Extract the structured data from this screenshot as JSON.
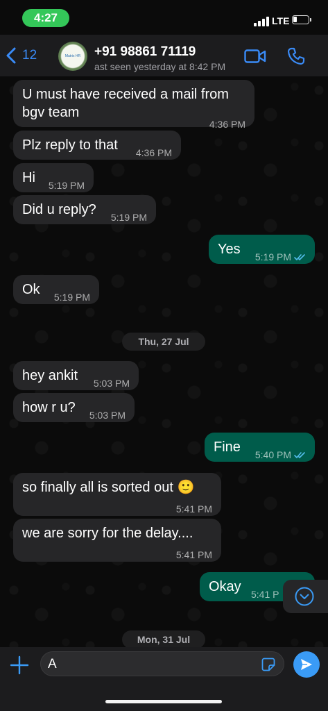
{
  "status_bar": {
    "time": "4:27",
    "network": "LTE",
    "time_pill_color": "#34c759"
  },
  "header": {
    "back_count": "12",
    "contact_name": "+91 98861 71119",
    "contact_status": "ast seen yesterday at 8:42 PM",
    "avatar_text": "Matrix HR",
    "accent_color": "#3a8bf7",
    "icons": [
      "chevron-left-icon",
      "video-call-icon",
      "phone-icon"
    ]
  },
  "messages": [
    {
      "dir": "in",
      "text1": "U must have received a mail from",
      "text2": "bgv team",
      "time": "4:36 PM"
    },
    {
      "dir": "in",
      "text": "Plz reply to that",
      "time": "4:36 PM"
    },
    {
      "dir": "in",
      "text": "Hi",
      "time": "5:19 PM"
    },
    {
      "dir": "in",
      "text": "Did u reply?",
      "time": "5:19 PM"
    },
    {
      "dir": "out",
      "text": "Yes",
      "time": "5:19 PM",
      "read": true
    },
    {
      "dir": "in",
      "text": "Ok",
      "time": "5:19 PM"
    },
    {
      "dir": "in",
      "text": "hey ankit",
      "time": "5:03 PM"
    },
    {
      "dir": "in",
      "text": "how r u?",
      "time": "5:03 PM"
    },
    {
      "dir": "out",
      "text": "Fine",
      "time": "5:40 PM",
      "read": true
    },
    {
      "dir": "in",
      "text": "so finally all is sorted out 🙂",
      "time": "5:41 PM"
    },
    {
      "dir": "in",
      "text": "we are sorry for the delay....",
      "time": "5:41 PM"
    },
    {
      "dir": "out",
      "text": "Okay",
      "time": "5:41 P"
    }
  ],
  "date_dividers": [
    "Thu, 27 Jul",
    "Mon, 31 Jul"
  ],
  "composer": {
    "value": "A",
    "send_color": "#3a9bf6"
  },
  "colors": {
    "incoming_bubble": "#262628",
    "outgoing_bubble": "#005c4b",
    "read_ticks": "#53bdeb"
  }
}
